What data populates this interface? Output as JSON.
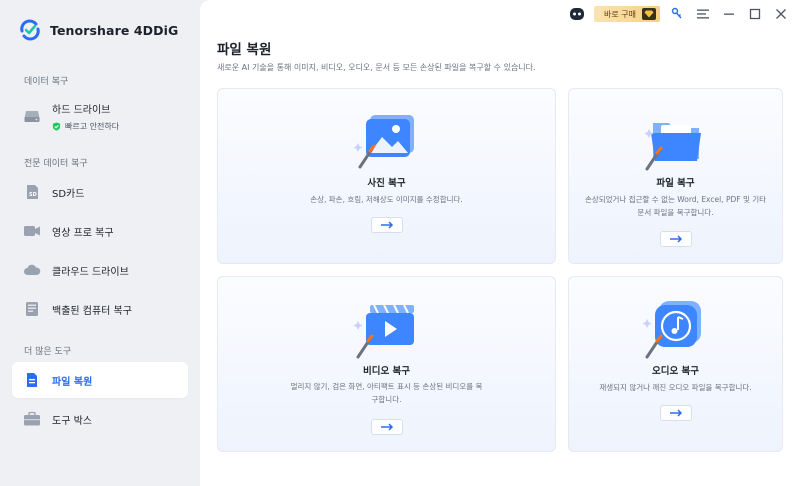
{
  "app": {
    "name": "Tenorshare 4DDiG"
  },
  "sidebar": {
    "sections": [
      {
        "title": "데이터 복구"
      },
      {
        "title": "전문 데이터 복구"
      },
      {
        "title": "더 많은 도구"
      }
    ],
    "hard_drive": {
      "label": "하드 드라이브",
      "sublabel": "빠르고 안전하다"
    },
    "items": [
      {
        "label": "SD카드"
      },
      {
        "label": "영상 프로 복구"
      },
      {
        "label": "클라우드 드라이브"
      },
      {
        "label": "백출된 컴퓨터 복구"
      },
      {
        "label": "파일 복원",
        "active": true
      },
      {
        "label": "도구 박스"
      }
    ]
  },
  "topbar": {
    "buy_label": "바로 구매"
  },
  "main": {
    "title": "파일 복원",
    "subtitle": "새로운 AI 기술을 통해 이미지, 비디오, 오디오, 문서 등 모든 손상된 파일을 복구할 수 있습니다.",
    "cards": [
      {
        "title": "사진 복구",
        "desc": "손상, 파손, 흐림, 저해상도 이미지를 수정합니다."
      },
      {
        "title": "파일 복구",
        "desc": "손상되었거나 접근할 수 없는 Word, Excel, PDF 및 기타 문서 파일을 복구합니다."
      },
      {
        "title": "비디오 복구",
        "desc": "멀리지 않기, 검은 화면, 아티팩트 표시 등 손상된 비디오를 복구합니다."
      },
      {
        "title": "오디오 복구",
        "desc": "재생되지 않거나 깨진 오디오 파일을 복구합니다."
      }
    ]
  },
  "colors": {
    "accent": "#2b6cf6",
    "sidebar_bg": "#eef0f4",
    "card_bg": "#f3f6fe"
  }
}
